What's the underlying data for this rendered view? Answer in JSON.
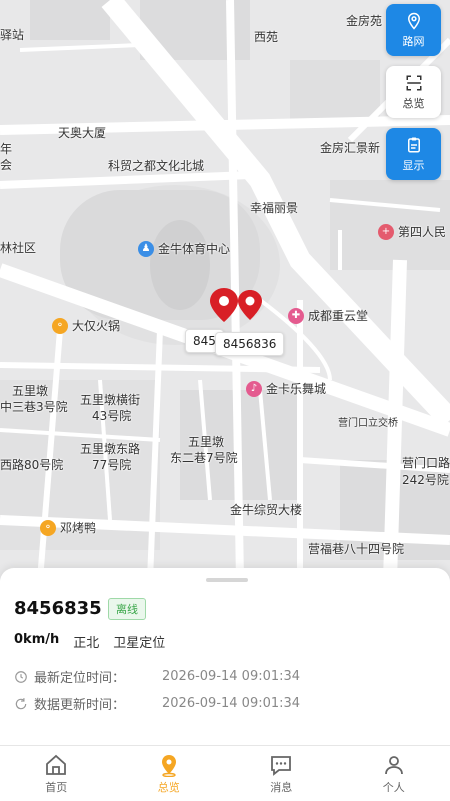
{
  "map": {
    "labels": {
      "yizhan": "驿站",
      "xiyuan": "西苑",
      "jinfangyuan": "金房苑",
      "tianaodasha": "天奥大厦",
      "kemao": "科贸之都文化北城",
      "jinfanghuijing": "金房汇景新",
      "xingfulijing": "幸福丽景",
      "linshequ": "林社区",
      "wulidun": "五里墩",
      "zhong3": "中三巷3号院",
      "hengjie": "五里墩横街",
      "hao43": "43号院",
      "dongjie": "五里墩东路",
      "hao77": "77号院",
      "xilu80": "西路80号院",
      "wulidun2": "五里墩",
      "dongerxiang": "东二巷7号院",
      "yingmenkou": "营门口立交桥",
      "yingmenkoulu": "营门口路",
      "hao242": "242号院",
      "jinzongmao": "金牛综贸大楼",
      "yingfuxiang": "营福巷八十四号院",
      "nian": "年",
      "hui": "会"
    },
    "pois": {
      "stadium": "金牛体育中心",
      "hotpot": "大仅火锅",
      "hospital": "第四人民",
      "chengdu_tang": "成都重云堂",
      "dance": "金卡乐舞城",
      "duck": "邓烤鸭"
    },
    "markers": {
      "tag_a": "845",
      "tag_b": "8456836"
    }
  },
  "buttons": {
    "route": "路网",
    "overview": "总览",
    "display": "显示"
  },
  "device": {
    "name": "8456835",
    "status": "离线",
    "speed": "0km/h",
    "direction": "正北",
    "positioning": "卫星定位",
    "loc_time_label": "最新定位时间：",
    "loc_time": "2026-09-14 09:01:34",
    "update_time_label": "数据更新时间：",
    "update_time": "2026-09-14 09:01:34"
  },
  "tabs": [
    {
      "label": "首页"
    },
    {
      "label": "总览"
    },
    {
      "label": "消息"
    },
    {
      "label": "个人"
    }
  ],
  "colors": {
    "accent": "#1e88e5",
    "active_tab": "#f5a623",
    "marker": "#e02424",
    "offline": "#3aa649"
  }
}
